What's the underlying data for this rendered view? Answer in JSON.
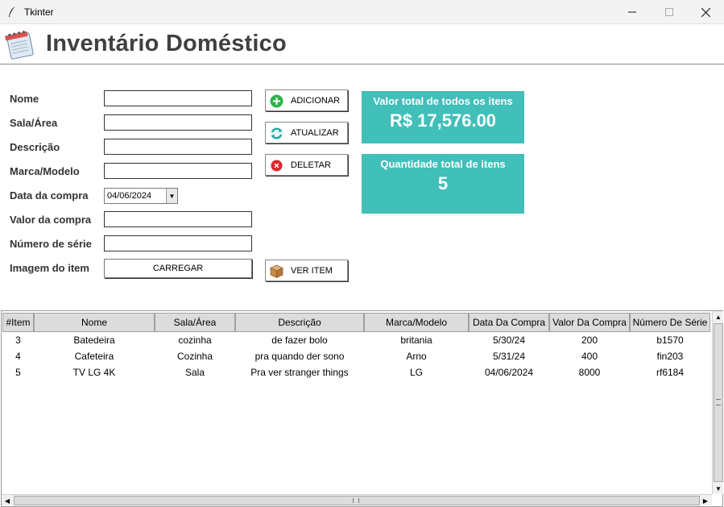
{
  "window": {
    "title": "Tkinter",
    "minimize": "—",
    "maximize": "☐",
    "close": "✕"
  },
  "header": {
    "title": "Inventário Doméstico",
    "icon": "notebook-icon"
  },
  "form": {
    "labels": {
      "nome": "Nome",
      "sala": "Sala/Área",
      "descricao": "Descrição",
      "marca": "Marca/Modelo",
      "data": "Data da compra",
      "valor": "Valor da compra",
      "serie": "Número de série",
      "imagem": "Imagem do item"
    },
    "values": {
      "nome": "",
      "sala": "",
      "descricao": "",
      "marca": "",
      "data": "04/06/2024",
      "valor": "",
      "serie": ""
    },
    "load_button": "CARREGAR"
  },
  "actions": {
    "add": "ADICIONAR",
    "update": "ATUALIZAR",
    "delete": "DELETAR",
    "view": "VER ITEM"
  },
  "stats": {
    "total_value_title": "Valor total de todos os itens",
    "total_value": "R$ 17,576.00",
    "total_qty_title": "Quantidade total de itens",
    "total_qty": "5"
  },
  "colors": {
    "stat_bg": "#41bfb9",
    "header_text": "#404040"
  },
  "table": {
    "columns": [
      "#Item",
      "Nome",
      "Sala/Área",
      "Descrição",
      "Marca/Modelo",
      "Data Da Compra",
      "Valor Da Compra",
      "Número De Série"
    ],
    "rows": [
      [
        "3",
        "Batedeira",
        "cozinha",
        "de fazer bolo",
        "britania",
        "5/30/24",
        "200",
        "b1570"
      ],
      [
        "4",
        "Cafeteira",
        "Cozinha",
        "pra quando der sono",
        "Arno",
        "5/31/24",
        "400",
        "fin203"
      ],
      [
        "5",
        "TV LG 4K",
        "Sala",
        "Pra ver stranger things",
        "LG",
        "04/06/2024",
        "8000",
        "rf6184"
      ]
    ]
  }
}
